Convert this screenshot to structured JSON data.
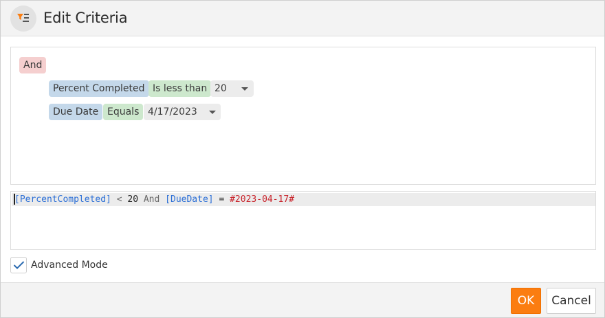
{
  "dialog": {
    "title": "Edit Criteria",
    "icon": "filter-list-icon",
    "accent_color": "#fb7d10"
  },
  "builder": {
    "group_operator": "And",
    "conditions": [
      {
        "field": "Percent Completed",
        "operator": "Is less than",
        "value": "20"
      },
      {
        "field": "Due Date",
        "operator": "Equals",
        "value": "4/17/2023"
      }
    ]
  },
  "expression": {
    "field1": "[PercentCompleted]",
    "op1": "<",
    "num1": "20",
    "joiner": "And",
    "field2": "[DueDate]",
    "op2": "=",
    "date2": "#2023-04-17#"
  },
  "advanced_mode": {
    "label": "Advanced Mode",
    "checked": true
  },
  "footer": {
    "ok_label": "OK",
    "cancel_label": "Cancel"
  }
}
